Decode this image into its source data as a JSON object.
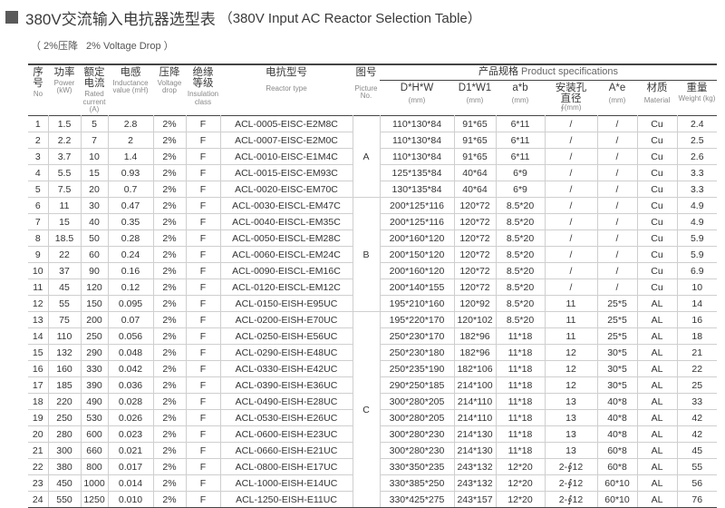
{
  "title": {
    "cn": "380V交流输入电抗器选型表",
    "en": "（380V Input AC Reactor Selection Table）"
  },
  "subtitle": {
    "cn": "（ 2%压降",
    "en": "2%  Voltage Drop ）"
  },
  "headers": {
    "no": {
      "cn": "序号",
      "en": "No"
    },
    "power": {
      "cn": "功率",
      "en": "Power (kW)"
    },
    "current": {
      "cn": "额定电流",
      "en": "Rated current (A)"
    },
    "inductance": {
      "cn": "电感",
      "en": "Inductance value (mH)"
    },
    "drop": {
      "cn": "压降",
      "en": "Voltage drop"
    },
    "insulation": {
      "cn": "绝缘等级",
      "en": "Insulation class"
    },
    "type": {
      "cn": "电抗型号",
      "en": "Reactor type"
    },
    "picture": {
      "cn": "图号",
      "en": "Picture No."
    },
    "spec": {
      "cn": "产品规格",
      "en": "Product specifications"
    },
    "dhw": {
      "cn": "D*H*W",
      "en": "(mm)"
    },
    "d1w1": {
      "cn": "D1*W1",
      "en": "(mm)"
    },
    "axb": {
      "cn": "a*b",
      "en": "(mm)"
    },
    "hole": {
      "cn": "安装孔直径",
      "en": "∮(mm)"
    },
    "axe": {
      "cn": "A*e",
      "en": "(mm)"
    },
    "material": {
      "cn": "材质",
      "en": "Material"
    },
    "weight": {
      "cn": "重量",
      "en": "Weight (kg)"
    }
  },
  "groups": [
    {
      "label": "A",
      "start": 0,
      "span": 5
    },
    {
      "label": "B",
      "start": 5,
      "span": 7
    },
    {
      "label": "C",
      "start": 12,
      "span": 12
    }
  ],
  "rows": [
    [
      "1",
      "1.5",
      "5",
      "2.8",
      "2%",
      "F",
      "ACL-0005-EISC-E2M8C",
      "110*130*84",
      "91*65",
      "6*11",
      "/",
      "/",
      "Cu",
      "2.4"
    ],
    [
      "2",
      "2.2",
      "7",
      "2",
      "2%",
      "F",
      "ACL-0007-EISC-E2M0C",
      "110*130*84",
      "91*65",
      "6*11",
      "/",
      "/",
      "Cu",
      "2.5"
    ],
    [
      "3",
      "3.7",
      "10",
      "1.4",
      "2%",
      "F",
      "ACL-0010-EISC-E1M4C",
      "110*130*84",
      "91*65",
      "6*11",
      "/",
      "/",
      "Cu",
      "2.6"
    ],
    [
      "4",
      "5.5",
      "15",
      "0.93",
      "2%",
      "F",
      "ACL-0015-EISC-EM93C",
      "125*135*84",
      "40*64",
      "6*9",
      "/",
      "/",
      "Cu",
      "3.3"
    ],
    [
      "5",
      "7.5",
      "20",
      "0.7",
      "2%",
      "F",
      "ACL-0020-EISC-EM70C",
      "130*135*84",
      "40*64",
      "6*9",
      "/",
      "/",
      "Cu",
      "3.3"
    ],
    [
      "6",
      "11",
      "30",
      "0.47",
      "2%",
      "F",
      "ACL-0030-EISCL-EM47C",
      "200*125*116",
      "120*72",
      "8.5*20",
      "/",
      "/",
      "Cu",
      "4.9"
    ],
    [
      "7",
      "15",
      "40",
      "0.35",
      "2%",
      "F",
      "ACL-0040-EISCL-EM35C",
      "200*125*116",
      "120*72",
      "8.5*20",
      "/",
      "/",
      "Cu",
      "4.9"
    ],
    [
      "8",
      "18.5",
      "50",
      "0.28",
      "2%",
      "F",
      "ACL-0050-EISCL-EM28C",
      "200*160*120",
      "120*72",
      "8.5*20",
      "/",
      "/",
      "Cu",
      "5.9"
    ],
    [
      "9",
      "22",
      "60",
      "0.24",
      "2%",
      "F",
      "ACL-0060-EISCL-EM24C",
      "200*150*120",
      "120*72",
      "8.5*20",
      "/",
      "/",
      "Cu",
      "5.9"
    ],
    [
      "10",
      "37",
      "90",
      "0.16",
      "2%",
      "F",
      "ACL-0090-EISCL-EM16C",
      "200*160*120",
      "120*72",
      "8.5*20",
      "/",
      "/",
      "Cu",
      "6.9"
    ],
    [
      "11",
      "45",
      "120",
      "0.12",
      "2%",
      "F",
      "ACL-0120-EISCL-EM12C",
      "200*140*155",
      "120*72",
      "8.5*20",
      "/",
      "/",
      "Cu",
      "10"
    ],
    [
      "12",
      "55",
      "150",
      "0.095",
      "2%",
      "F",
      "ACL-0150-EISH-E95UC",
      "195*210*160",
      "120*92",
      "8.5*20",
      "11",
      "25*5",
      "AL",
      "14"
    ],
    [
      "13",
      "75",
      "200",
      "0.07",
      "2%",
      "F",
      "ACL-0200-EISH-E70UC",
      "195*220*170",
      "120*102",
      "8.5*20",
      "11",
      "25*5",
      "AL",
      "16"
    ],
    [
      "14",
      "110",
      "250",
      "0.056",
      "2%",
      "F",
      "ACL-0250-EISH-E56UC",
      "250*230*170",
      "182*96",
      "11*18",
      "11",
      "25*5",
      "AL",
      "18"
    ],
    [
      "15",
      "132",
      "290",
      "0.048",
      "2%",
      "F",
      "ACL-0290-EISH-E48UC",
      "250*230*180",
      "182*96",
      "11*18",
      "12",
      "30*5",
      "AL",
      "21"
    ],
    [
      "16",
      "160",
      "330",
      "0.042",
      "2%",
      "F",
      "ACL-0330-EISH-E42UC",
      "250*235*190",
      "182*106",
      "11*18",
      "12",
      "30*5",
      "AL",
      "22"
    ],
    [
      "17",
      "185",
      "390",
      "0.036",
      "2%",
      "F",
      "ACL-0390-EISH-E36UC",
      "290*250*185",
      "214*100",
      "11*18",
      "12",
      "30*5",
      "AL",
      "25"
    ],
    [
      "18",
      "220",
      "490",
      "0.028",
      "2%",
      "F",
      "ACL-0490-EISH-E28UC",
      "300*280*205",
      "214*110",
      "11*18",
      "13",
      "40*8",
      "AL",
      "33"
    ],
    [
      "19",
      "250",
      "530",
      "0.026",
      "2%",
      "F",
      "ACL-0530-EISH-E26UC",
      "300*280*205",
      "214*110",
      "11*18",
      "13",
      "40*8",
      "AL",
      "42"
    ],
    [
      "20",
      "280",
      "600",
      "0.023",
      "2%",
      "F",
      "ACL-0600-EISH-E23UC",
      "300*280*230",
      "214*130",
      "11*18",
      "13",
      "40*8",
      "AL",
      "42"
    ],
    [
      "21",
      "300",
      "660",
      "0.021",
      "2%",
      "F",
      "ACL-0660-EISH-E21UC",
      "300*280*230",
      "214*130",
      "11*18",
      "13",
      "60*8",
      "AL",
      "45"
    ],
    [
      "22",
      "380",
      "800",
      "0.017",
      "2%",
      "F",
      "ACL-0800-EISH-E17UC",
      "330*350*235",
      "243*132",
      "12*20",
      "2-∮12",
      "60*8",
      "AL",
      "55"
    ],
    [
      "23",
      "450",
      "1000",
      "0.014",
      "2%",
      "F",
      "ACL-1000-EISH-E14UC",
      "330*385*250",
      "243*132",
      "12*20",
      "2-∮12",
      "60*10",
      "AL",
      "56"
    ],
    [
      "24",
      "550",
      "1250",
      "0.010",
      "2%",
      "F",
      "ACL-1250-EISH-E11UC",
      "330*425*275",
      "243*157",
      "12*20",
      "2-∮12",
      "60*10",
      "AL",
      "76"
    ]
  ]
}
